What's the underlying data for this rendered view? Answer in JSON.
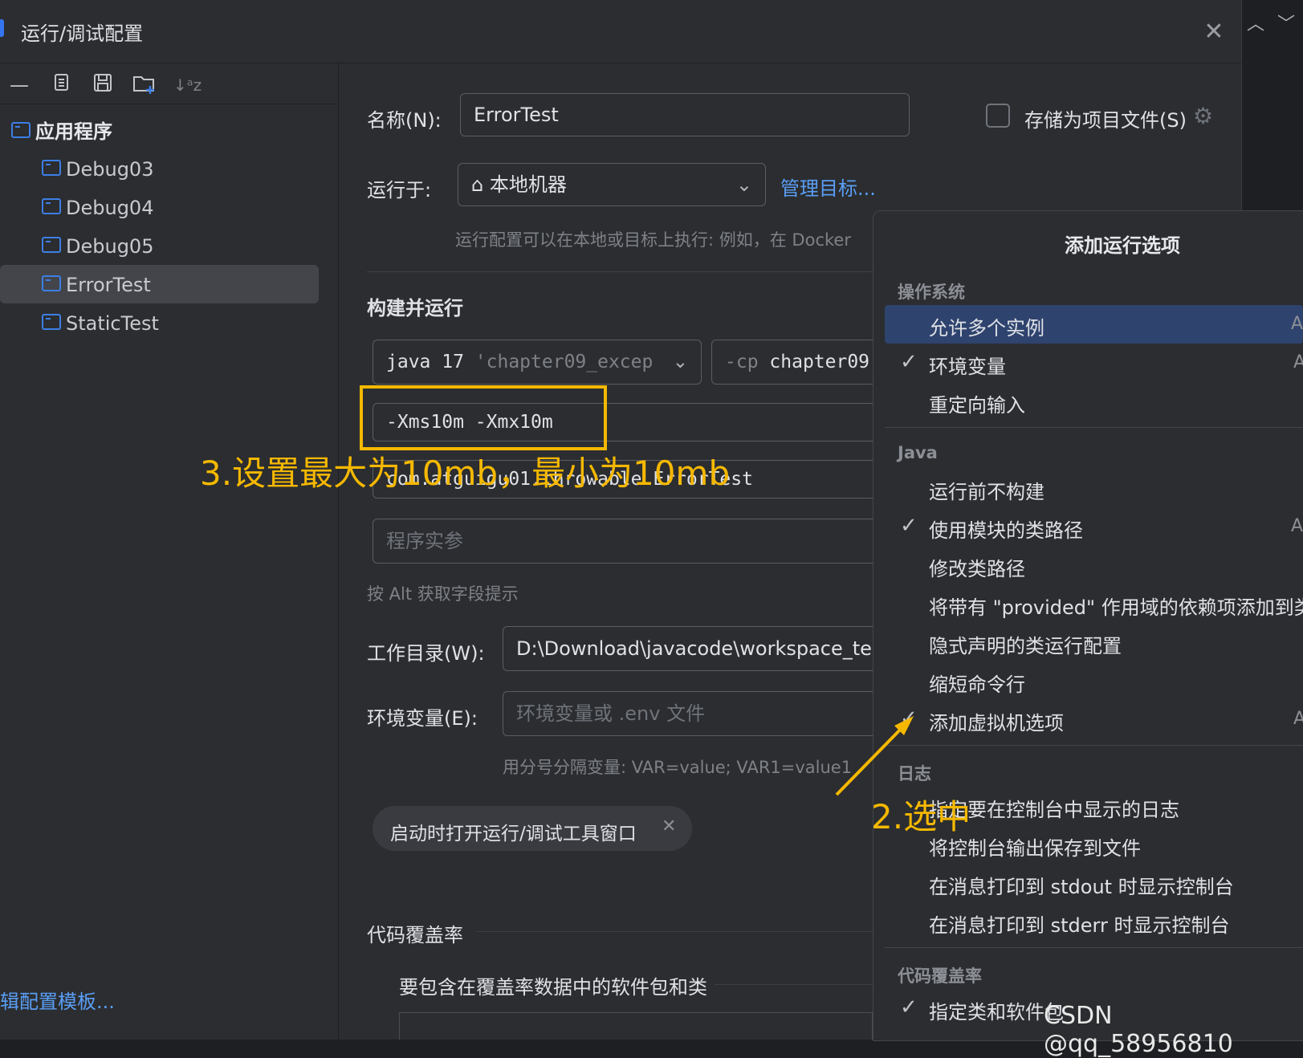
{
  "window": {
    "title": "运行/调试配置",
    "close_icon": "close-icon",
    "strip_icons": [
      "chevron-up-icon",
      "chevron-down-icon"
    ]
  },
  "toolbar": {
    "icons": [
      "remove-icon",
      "copy-icon",
      "save-icon",
      "new-folder-icon",
      "sort-icon"
    ],
    "sort_glyph": "↓ᵃz"
  },
  "tree": {
    "root": "应用程序",
    "items": [
      "Debug03",
      "Debug04",
      "Debug05",
      "ErrorTest",
      "StaticTest"
    ],
    "selected": "ErrorTest",
    "template_link": "辑配置模板..."
  },
  "form": {
    "name_label": "名称(N):",
    "name_value": "ErrorTest",
    "store_label": "存储为项目文件(S)",
    "run_on_label": "运行于:",
    "run_on_value": "本地机器",
    "manage_targets": "管理目标...",
    "run_on_hint": "运行配置可以在本地或目标上执行: 例如，在 Docker",
    "build_run_title": "构建并运行",
    "jre_value": "java 17",
    "jre_detail": "'chapter09_excep",
    "cp_prefix": "-cp",
    "cp_value": "chapter09",
    "vm_options": "-Xms10m -Xmx10m",
    "main_class": "com.atguigu01.throwable.ErrorTest",
    "program_args_placeholder": "程序实参",
    "alt_hint": "按 Alt 获取字段提示",
    "workdir_label": "工作目录(W):",
    "workdir_value": "D:\\Download\\javacode\\workspace_tea",
    "env_label": "环境变量(E):",
    "env_placeholder": "环境变量或 .env 文件",
    "env_hint": "用分号分隔变量: VAR=value; VAR1=value1",
    "chip_label": "启动时打开运行/调试工具窗口",
    "coverage_title": "代码覆盖率",
    "coverage_sub": "要包含在覆盖率数据中的软件包和类"
  },
  "popup": {
    "title": "添加运行选项",
    "sections": {
      "os": "操作系统",
      "java": "Java",
      "log": "日志",
      "coverage": "代码覆盖率"
    },
    "os_items": [
      {
        "label": "允许多个实例",
        "checked": false,
        "shortcut": "A"
      },
      {
        "label": "环境变量",
        "checked": true,
        "shortcut": "A"
      },
      {
        "label": "重定向输入",
        "checked": false,
        "shortcut": ""
      }
    ],
    "java_items": [
      {
        "label": "运行前不构建",
        "checked": false,
        "shortcut": ""
      },
      {
        "label": "使用模块的类路径",
        "checked": true,
        "shortcut": "A"
      },
      {
        "label": "修改类路径",
        "checked": false,
        "shortcut": ""
      },
      {
        "label": "将带有 \"provided\" 作用域的依赖项添加到类",
        "checked": false,
        "shortcut": ""
      },
      {
        "label": "隐式声明的类运行配置",
        "checked": false,
        "shortcut": ""
      },
      {
        "label": "缩短命令行",
        "checked": false,
        "shortcut": ""
      },
      {
        "label": "添加虚拟机选项",
        "checked": true,
        "shortcut": "A"
      }
    ],
    "log_items": [
      {
        "label": "指定要在控制台中显示的日志",
        "checked": false
      },
      {
        "label": "将控制台输出保存到文件",
        "checked": false
      },
      {
        "label": "在消息打印到 stdout 时显示控制台",
        "checked": false
      },
      {
        "label": "在消息打印到 stderr 时显示控制台",
        "checked": false
      }
    ],
    "coverage_items": [
      {
        "label": "指定类和软件包",
        "checked": true
      }
    ]
  },
  "annotations": {
    "step3": "3.设置最大为10mb，最小为10mb",
    "step2": "2.选中",
    "color": "#f5b800"
  },
  "watermark": "CSDN @qq_58956810"
}
